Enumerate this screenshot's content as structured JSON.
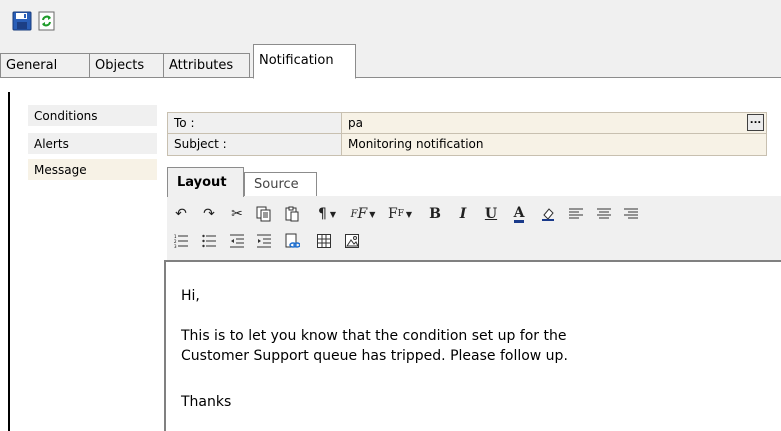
{
  "top_toolbar": {
    "save_icon": "floppy-disk-icon",
    "refresh_icon": "refresh-icon"
  },
  "tabs": [
    {
      "label": "General"
    },
    {
      "label": "Objects"
    },
    {
      "label": "Attributes"
    },
    {
      "label": "Notification"
    }
  ],
  "active_tab": "Notification",
  "sidebar": {
    "items": [
      {
        "label": "Conditions"
      },
      {
        "label": "Alerts"
      },
      {
        "label": "Message"
      }
    ],
    "active": "Message"
  },
  "fields": {
    "to": {
      "label": "To :",
      "value": "pa",
      "button": "..."
    },
    "subject": {
      "label": "Subject :",
      "value": "Monitoring notification"
    }
  },
  "editor_tabs": [
    {
      "label": "Layout"
    },
    {
      "label": "Source"
    }
  ],
  "active_editor_tab": "Layout",
  "editor_toolbar": {
    "row1": [
      "undo-icon",
      "redo-icon",
      "cut-icon",
      "copy-icon",
      "paste-icon",
      "paragraph-format-icon",
      "font-family-icon",
      "font-size-icon",
      "bold-icon",
      "italic-icon",
      "underline-icon",
      "font-color-icon",
      "highlight-icon",
      "align-left-icon",
      "align-center-icon",
      "align-right-icon"
    ],
    "row2": [
      "ordered-list-icon",
      "unordered-list-icon",
      "outdent-icon",
      "indent-icon",
      "insert-link-icon",
      "insert-table-icon",
      "insert-image-icon"
    ]
  },
  "message": {
    "greeting": "Hi,",
    "body_line1": "This is to let you know that the condition set up for the",
    "body_line2": "Customer Support queue has tripped. Please follow up.",
    "closing": "Thanks"
  }
}
